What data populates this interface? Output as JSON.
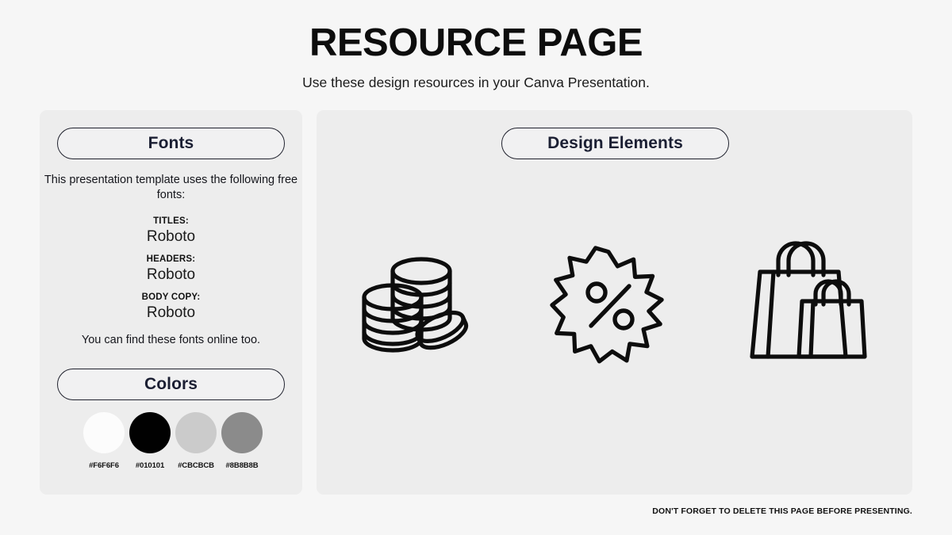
{
  "header": {
    "title": "RESOURCE PAGE",
    "subtitle": "Use these design resources in your Canva Presentation."
  },
  "fonts_panel": {
    "heading": "Fonts",
    "intro": "This presentation template uses the following free fonts:",
    "groups": [
      {
        "role": "TITLES:",
        "name": "Roboto"
      },
      {
        "role": "HEADERS:",
        "name": "Roboto"
      },
      {
        "role": "BODY COPY:",
        "name": "Roboto"
      }
    ],
    "outro": "You can find these fonts online too."
  },
  "colors_panel": {
    "heading": "Colors",
    "swatches": [
      {
        "hex": "#F6F6F6",
        "color": "#FCFCFC"
      },
      {
        "hex": "#010101",
        "color": "#010101"
      },
      {
        "hex": "#CBCBCB",
        "color": "#CBCBCB"
      },
      {
        "hex": "#8B8B8B",
        "color": "#8B8B8B"
      }
    ]
  },
  "design_panel": {
    "heading": "Design Elements",
    "icons": [
      {
        "name": "stacked-coins-icon"
      },
      {
        "name": "discount-starburst-icon"
      },
      {
        "name": "shopping-bags-icon"
      }
    ]
  },
  "footer": {
    "note": "DON'T FORGET TO DELETE THIS PAGE BEFORE PRESENTING."
  },
  "theme": {
    "background": "#F6F6F6",
    "panel_background": "#EDEDED",
    "pill_border": "#20222E",
    "text": "#111111",
    "icon_stroke": "#0D0D0D"
  }
}
